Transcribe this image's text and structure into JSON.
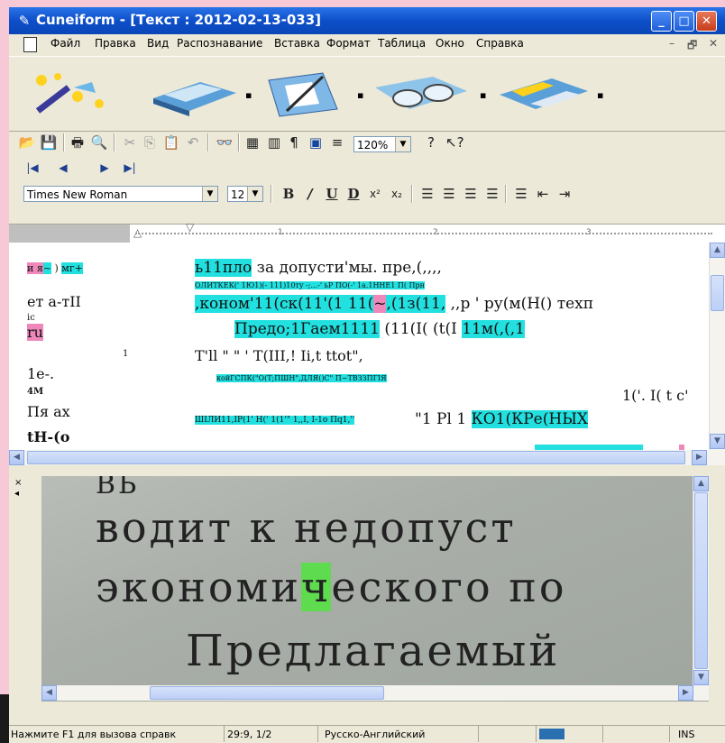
{
  "window": {
    "title": "Cuneiform - [Текст : 2012-02-13-033]",
    "title_colors": {
      "bar": "#0d4fc9",
      "close": "#c63d1c"
    }
  },
  "menu": [
    "Файл",
    "Правка",
    "Вид",
    "Распознавание",
    "Вставка",
    "Формат",
    "Таблица",
    "Окно",
    "Справка"
  ],
  "format_bar": {
    "font": "Times New Roman",
    "size": "12",
    "zoom": "120%"
  },
  "text_lines": [
    "и я~ ) мг+",
    "ь11пло за допусти'мы. пре,(,,,,",
    "ОЛИТКЕК(' 1Ю1)(- 111)10ту -;...-' ьР ПО(-' 1а.1ННЕ1 П( Прн",
    "ет а-тІІ",
    ",коном'1",
    "1 (ск(11'(1 11(",
    "~",
    ",(1з(11, ,,р ' ру(м(Н() техп",
    "іс",
    "ru",
    "Предо;1Гаем1111",
    "(11(І( (t(І",
    "11м(,(,1",
    "1",
    "Т'll \" \" ' Т(ІІІ,! Ii,t ttot\",",
    "1е-.",
    "койГСПК(\"О(Т;ПШН\",ДЛЯ()С\" П~ТВЗЗПГІЯ",
    "4M",
    "1('. I( t c'",
    "Пя   ах",
    "ШІЛИ11,ІР(1' Н(' 1(1'\" 1,,І, І-1о Пq1,''",
    "\"1  Pl 1",
    "КО1(КРе(НЫХ",
    "tH-(o"
  ],
  "image_lines": [
    "ВЬ",
    "водит  к  недопуст",
    "экономи",
    "ч",
    "еского  по",
    "Предлагаемый"
  ],
  "status": {
    "hint": "Нажмите F1 для вызова справк",
    "pos": "29:9,  1/2",
    "lang": "Русско-Английский",
    "mode": "INS"
  },
  "icons": [
    "wand-icon",
    "scanner-icon",
    "layout-icon",
    "glasses-icon",
    "save-disk-icon",
    "open-icon",
    "save-icon",
    "print-icon",
    "preview-icon",
    "cut-icon",
    "copy-icon",
    "paste-icon",
    "undo-icon",
    "find-icon",
    "table-icon",
    "columns-icon",
    "pilcrow-icon",
    "frame-icon",
    "align-icon",
    "help-icon",
    "whats-this-icon"
  ]
}
